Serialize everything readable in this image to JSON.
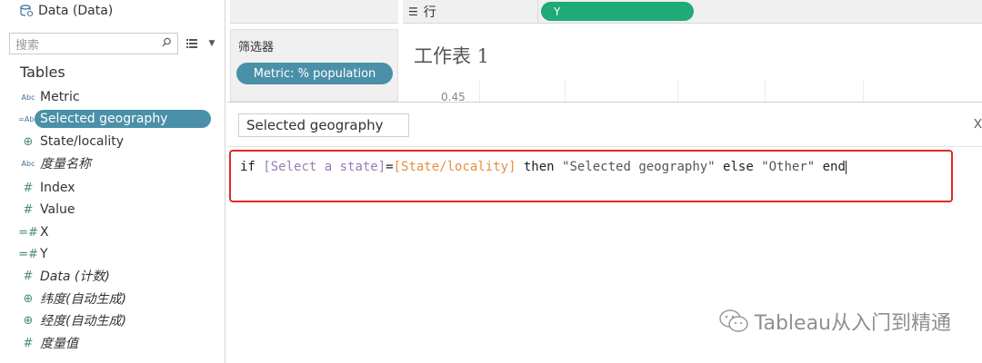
{
  "data_pane": {
    "datasource_title": "Data (Data)",
    "search_placeholder": "搜索",
    "tables_heading": "Tables",
    "fields": [
      {
        "label": "Metric",
        "type": "abc",
        "italic": false
      },
      {
        "label": "Selected geography",
        "type": "calc-abc",
        "italic": false,
        "selected": true
      },
      {
        "label": "State/locality",
        "type": "globe",
        "italic": false
      },
      {
        "label": "度量名称",
        "type": "abc",
        "italic": true
      },
      {
        "label": "Index",
        "type": "hash",
        "italic": false
      },
      {
        "label": "Value",
        "type": "hash",
        "italic": false
      },
      {
        "label": "X",
        "type": "calc-hash",
        "italic": false
      },
      {
        "label": "Y",
        "type": "calc-hash",
        "italic": false
      },
      {
        "label": "Data (计数)",
        "type": "hash",
        "italic": true
      },
      {
        "label": "纬度(自动生成)",
        "type": "globe",
        "italic": true
      },
      {
        "label": "经度(自动生成)",
        "type": "globe",
        "italic": true
      },
      {
        "label": "度量值",
        "type": "hash",
        "italic": true
      }
    ]
  },
  "shelves": {
    "rows_label": "行",
    "rows_pill": "Y"
  },
  "filters": {
    "title": "筛选器",
    "pill": "Metric: % population"
  },
  "sheet": {
    "title": "工作表 1",
    "axis_tick": "0.45"
  },
  "calc_editor": {
    "name": "Selected geography",
    "formula": {
      "kw_if": "if ",
      "field1": "[Select a state]",
      "op": "=",
      "field2": "[State/locality]",
      "kw_then": " then ",
      "str1": "\"Selected geography\"",
      "kw_else": " else ",
      "str2": "\"Other\"",
      "kw_end": " end"
    }
  },
  "watermark": {
    "text": "Tableau从入门到精通"
  },
  "colors": {
    "selected_pill": "#4a90a8",
    "rows_pill": "#1faa76",
    "highlight_box": "#e02a2a"
  }
}
